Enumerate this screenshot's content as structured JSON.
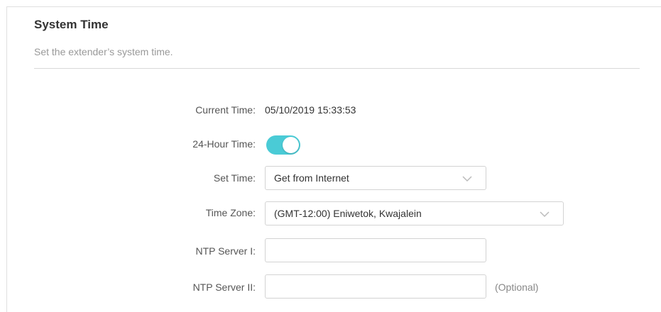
{
  "section": {
    "title": "System Time",
    "subtitle": "Set the extender’s system time."
  },
  "form": {
    "current_time_label": "Current Time:",
    "current_time_value": "05/10/2019 15:33:53",
    "hour24_label": "24-Hour Time:",
    "hour24_enabled": true,
    "set_time_label": "Set Time:",
    "set_time_value": "Get from Internet",
    "time_zone_label": "Time Zone:",
    "time_zone_value": "(GMT-12:00) Eniwetok, Kwajalein",
    "ntp1_label": "NTP Server I:",
    "ntp1_value": "",
    "ntp2_label": "NTP Server II:",
    "ntp2_value": "",
    "ntp2_hint": "(Optional)"
  },
  "colors": {
    "toggle_on": "#4acbd6",
    "border": "#d3d3d3"
  },
  "icons": {
    "dropdown": "chevron-down-icon"
  }
}
